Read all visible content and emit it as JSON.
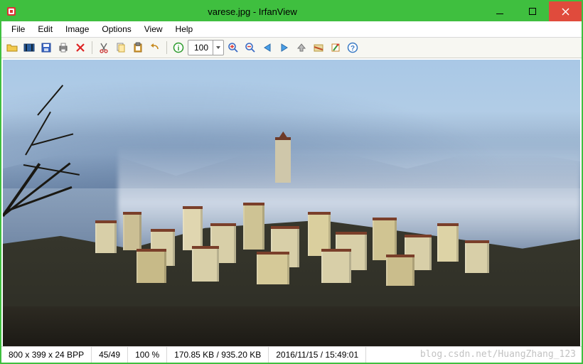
{
  "title": "varese.jpg - IrfanView",
  "menu": [
    "File",
    "Edit",
    "Image",
    "Options",
    "View",
    "Help"
  ],
  "toolbar": {
    "zoom_value": "100",
    "icons": [
      "open-icon",
      "slideshow-icon",
      "save-icon",
      "print-icon",
      "delete-icon",
      "sep",
      "cut-icon",
      "copy-icon",
      "paste-icon",
      "undo-icon",
      "sep",
      "info-icon",
      "zoom",
      "zoom-in-icon",
      "zoom-out-icon",
      "prev-icon",
      "next-icon",
      "up-icon",
      "scan-icon",
      "settings-icon",
      "help-icon"
    ]
  },
  "status": {
    "dims": "800 x 399 x 24 BPP",
    "frame": "45/49",
    "zoom": "100 %",
    "size": "170.85 KB / 935.20 KB",
    "datetime": "2016/11/15 / 15:49:01"
  },
  "watermark": "blog.csdn.net/HuangZhang_123",
  "image_description": "Hilltop Italian town (Varese) with clustered beige buildings and terracotta roofs, a central bell tower, bare winter tree branches in the left foreground, and layered misty blue mountain ridges receding into the background under a pale sky."
}
